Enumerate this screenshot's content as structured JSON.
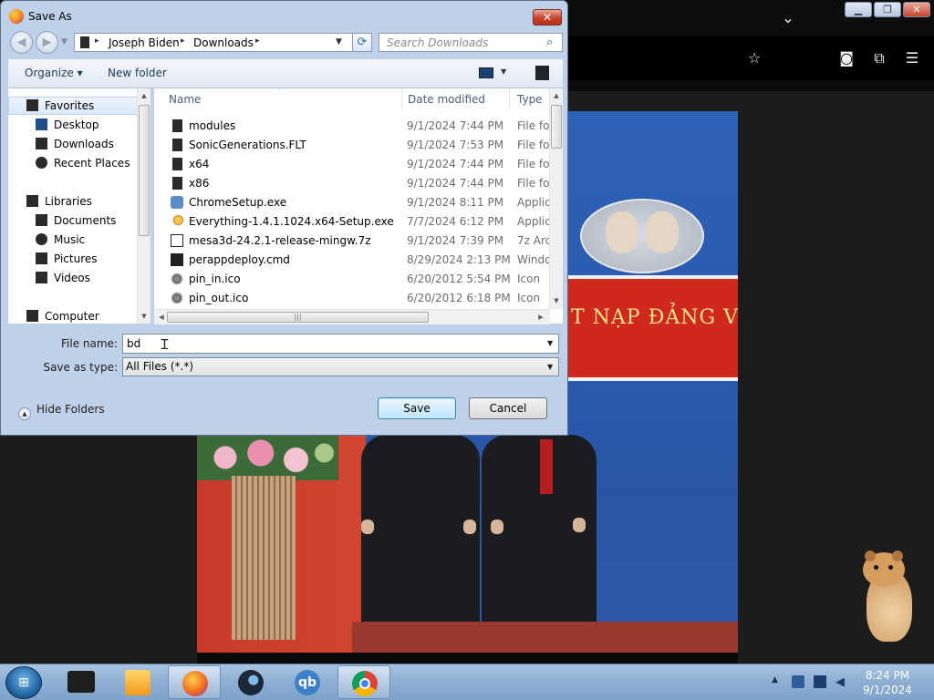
{
  "dialog": {
    "title": "Save As",
    "close_glyph": "✕",
    "address": {
      "crumbs": [
        "Joseph Biden",
        "Downloads"
      ],
      "separator": "▸"
    },
    "search": {
      "placeholder": "Search Downloads"
    },
    "toolbar": {
      "organize_label": "Organize ▾",
      "new_folder_label": "New folder"
    },
    "nav_pane": {
      "groups": [
        {
          "label": "Favorites",
          "items": [
            "Desktop",
            "Downloads",
            "Recent Places"
          ]
        },
        {
          "label": "Libraries",
          "items": [
            "Documents",
            "Music",
            "Pictures",
            "Videos"
          ]
        },
        {
          "label": "Computer",
          "items": []
        }
      ]
    },
    "columns": [
      "Name",
      "Date modified",
      "Type"
    ],
    "files": [
      {
        "name": "modules",
        "date": "9/1/2024 7:44 PM",
        "type": "File fol",
        "icon": "folder-icon"
      },
      {
        "name": "SonicGenerations.FLT",
        "date": "9/1/2024 7:53 PM",
        "type": "File fol",
        "icon": "folder-icon"
      },
      {
        "name": "x64",
        "date": "9/1/2024 7:44 PM",
        "type": "File fol",
        "icon": "folder-icon"
      },
      {
        "name": "x86",
        "date": "9/1/2024 7:44 PM",
        "type": "File fol",
        "icon": "folder-icon"
      },
      {
        "name": "ChromeSetup.exe",
        "date": "9/1/2024 8:11 PM",
        "type": "Applic",
        "icon": "installer-icon"
      },
      {
        "name": "Everything-1.4.1.1024.x64-Setup.exe",
        "date": "7/7/2024 6:12 PM",
        "type": "Applic",
        "icon": "magnifier-installer-icon"
      },
      {
        "name": "mesa3d-24.2.1-release-mingw.7z",
        "date": "9/1/2024 7:39 PM",
        "type": "7z Arch",
        "icon": "archive-icon"
      },
      {
        "name": "perappdeploy.cmd",
        "date": "8/29/2024 2:13 PM",
        "type": "Windo",
        "icon": "script-icon"
      },
      {
        "name": "pin_in.ico",
        "date": "6/20/2012 5:54 PM",
        "type": "Icon",
        "icon": "pin-icon"
      },
      {
        "name": "pin_out.ico",
        "date": "6/20/2012 6:18 PM",
        "type": "Icon",
        "icon": "pin-icon"
      }
    ],
    "file_name": {
      "label": "File name:",
      "value": "bd"
    },
    "save_as_type": {
      "label": "Save as type:",
      "value": "All Files (*.*)"
    },
    "hide_folders_label": "Hide Folders",
    "save_label": "Save",
    "cancel_label": "Cancel"
  },
  "video": {
    "banner_text": "T NẠP ĐẢNG V"
  },
  "taskbar": {
    "apps": [
      "Media player",
      "Firefox",
      "Steam",
      "qBittorrent",
      "Chrome"
    ],
    "qb_label": "qb",
    "clock_time": "8:24 PM",
    "clock_date": "9/1/2024"
  },
  "colors": {
    "accent": "#3c7fb1",
    "close_red": "#c9432c",
    "taskbar": "#8fb0d4"
  }
}
